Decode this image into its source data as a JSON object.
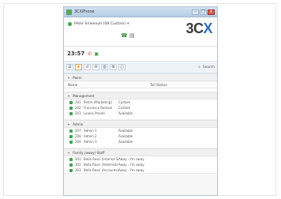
{
  "window": {
    "title": "3CXPhone",
    "controls": [
      "minimize",
      "maximize",
      "close"
    ]
  },
  "header": {
    "presence_label": "Peter Smeenuh (08 Custom)",
    "brand_prefix": "3C",
    "brand_suffix": "X",
    "icons": [
      "phone-icon",
      "voicemail-icon"
    ]
  },
  "timebar": {
    "time": "23:57",
    "icons": [
      "call-icon-red",
      "contacts-icon"
    ]
  },
  "toolbar": {
    "buttons": [
      "contacts",
      "favorites",
      "history",
      "chat",
      "voicemail",
      "settings",
      "conference"
    ],
    "search_label": "Search"
  },
  "list": {
    "top_section": "Peers",
    "columns": {
      "name": "Name",
      "status": "Toll Status"
    },
    "groups": [
      {
        "title": "Management",
        "rows": [
          {
            "ext": "201",
            "name": "Pietro (Marketing)",
            "status": "Custom"
          },
          {
            "ext": "202",
            "name": "Francesco Romani",
            "status": "Custom"
          },
          {
            "ext": "203",
            "name": "Louise Prandi",
            "status": "Available"
          }
        ]
      },
      {
        "title": "Admin",
        "rows": [
          {
            "ext": "207",
            "name": "Admin 1",
            "status": "Available"
          },
          {
            "ext": "208",
            "name": "Admin 2",
            "status": "Available"
          },
          {
            "ext": "209",
            "name": "Admin 3",
            "status": "Available"
          }
        ]
      },
      {
        "title": "Family (away) Staff",
        "rows": [
          {
            "ext": "301",
            "name": "Bella Rossi (Internal Sale)",
            "status": "Away - I'm away"
          },
          {
            "ext": "302",
            "name": "Bella Rossi (Administrative)",
            "status": "Away - I'm away"
          },
          {
            "ext": "303",
            "name": "Bella Rossi (Accounts)",
            "status": "Away - I'm away"
          }
        ]
      }
    ]
  },
  "colors": {
    "online": "#3aa64a",
    "brand_blue": "#2e6fb6",
    "accent_red": "#c43b2e"
  }
}
